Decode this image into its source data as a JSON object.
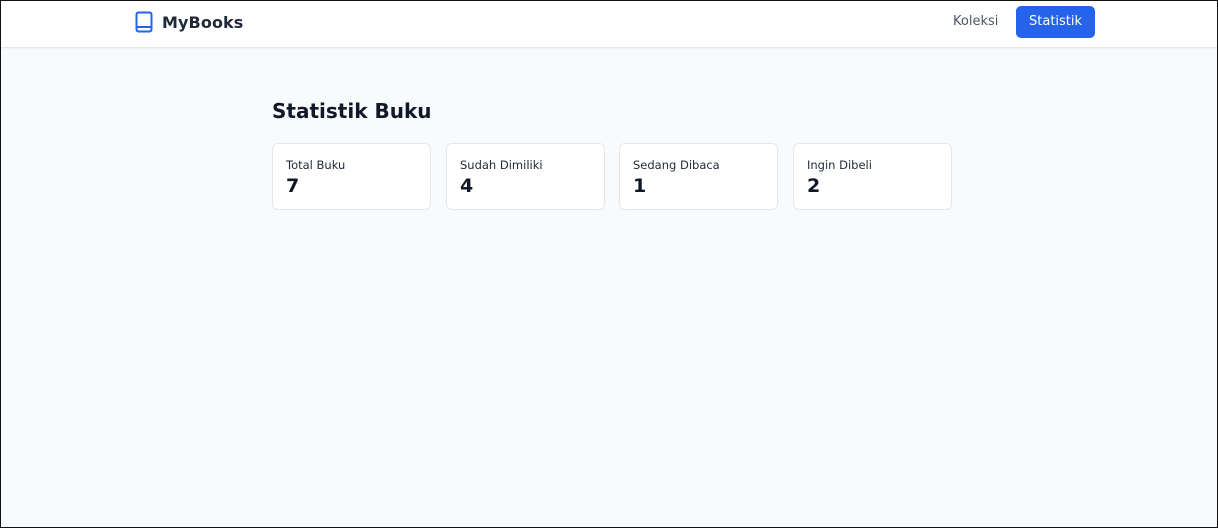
{
  "app": {
    "brand_name": "MyBooks",
    "brand_icon": "book-icon"
  },
  "nav": {
    "items": [
      {
        "label": "Koleksi",
        "active": false
      },
      {
        "label": "Statistik",
        "active": true
      }
    ]
  },
  "colors": {
    "accent": "#2563eb",
    "background": "#f8fafc",
    "card": "#ffffff",
    "border": "#e5e7eb"
  },
  "main": {
    "title": "Statistik Buku",
    "stats": [
      {
        "label": "Total Buku",
        "value": "7"
      },
      {
        "label": "Sudah Dimiliki",
        "value": "4"
      },
      {
        "label": "Sedang Dibaca",
        "value": "1"
      },
      {
        "label": "Ingin Dibeli",
        "value": "2"
      }
    ]
  }
}
